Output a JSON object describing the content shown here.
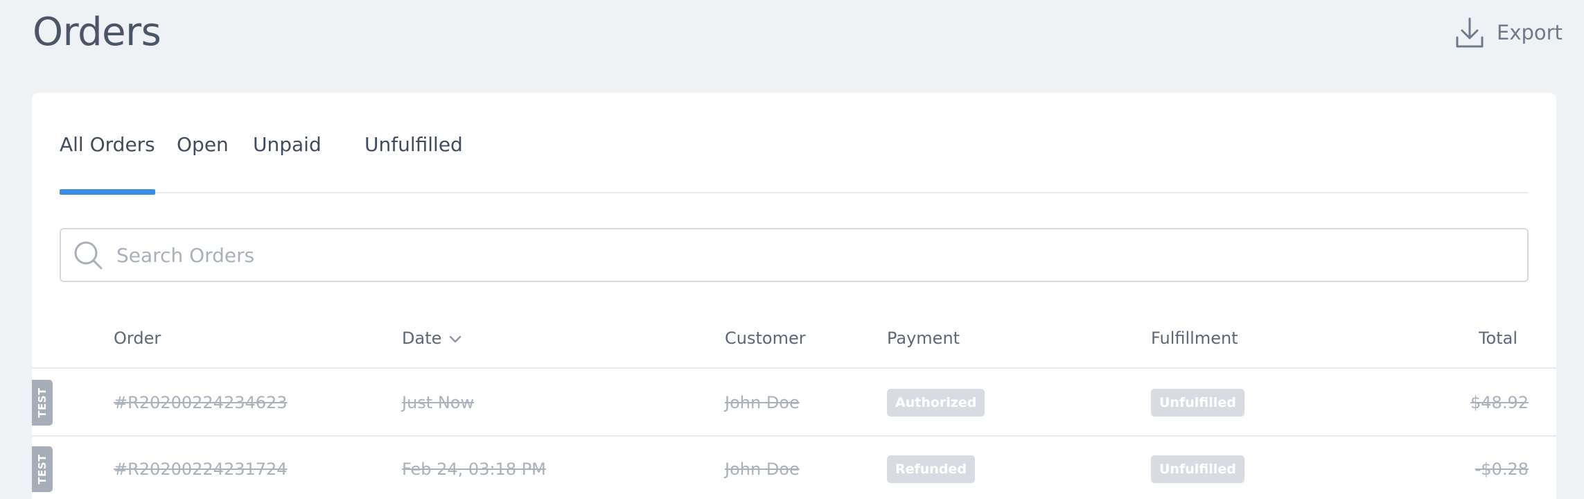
{
  "page": {
    "title": "Orders"
  },
  "toolbar": {
    "export_label": "Export"
  },
  "tabs": [
    {
      "label": "All Orders",
      "active": true
    },
    {
      "label": "Open",
      "active": false
    },
    {
      "label": "Unpaid",
      "active": false
    },
    {
      "label": "Unfulfilled",
      "active": false
    }
  ],
  "search": {
    "placeholder": "Search Orders",
    "value": ""
  },
  "table": {
    "columns": {
      "order": "Order",
      "date": "Date",
      "customer": "Customer",
      "payment": "Payment",
      "fulfillment": "Fulfillment",
      "total": "Total"
    },
    "rows": [
      {
        "tag": "TEST",
        "order": "#R20200224234623",
        "date": "Just Now",
        "customer": "John Doe",
        "payment": "Authorized",
        "fulfillment": "Unfulfilled",
        "total": "$48.92"
      },
      {
        "tag": "TEST",
        "order": "#R20200224231724",
        "date": "Feb 24, 03:18 PM",
        "customer": "John Doe",
        "payment": "Refunded",
        "fulfillment": "Unfulfilled",
        "total": "-$0.28"
      }
    ]
  },
  "colors": {
    "accent": "#3b8beb",
    "background": "#eff2f5",
    "badge": "#d8dce2",
    "test_tag": "#a6adb8"
  },
  "icons": {
    "export": "download-icon",
    "search": "search-icon",
    "sort": "chevron-down-icon"
  }
}
